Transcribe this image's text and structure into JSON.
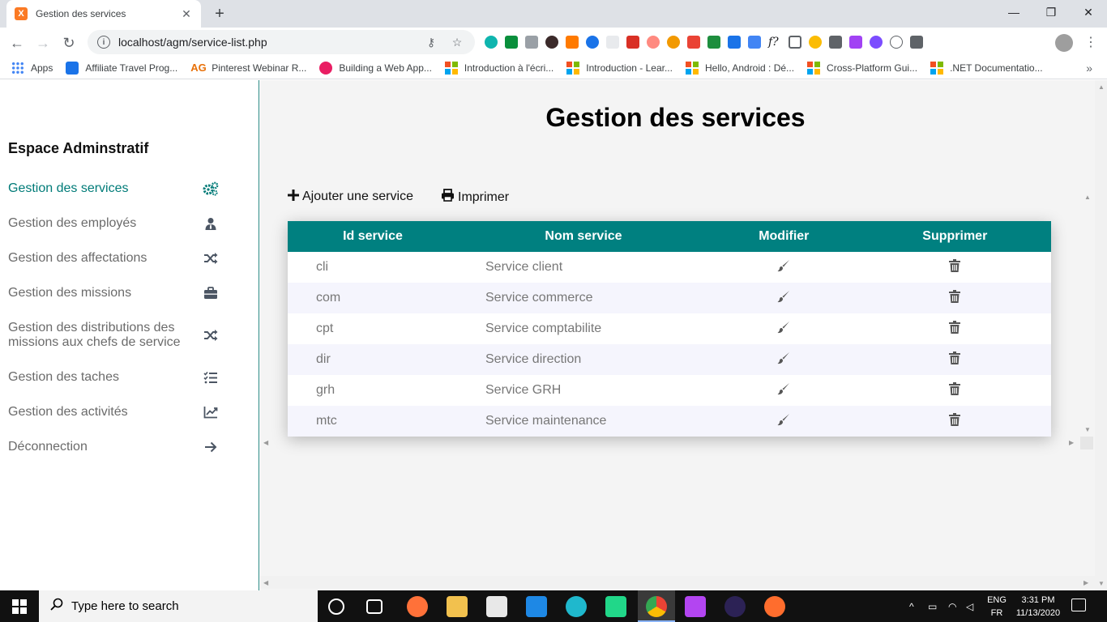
{
  "browser": {
    "tab_title": "Gestion des services",
    "tab_favicon": "X",
    "url": "localhost/agm/service-list.php",
    "bookmarks": [
      {
        "label": "Apps",
        "icon": "apps-grid-icon"
      },
      {
        "label": "Affiliate Travel Prog...",
        "icon": "booking-icon"
      },
      {
        "label": "Pinterest Webinar R...",
        "icon": "ag-icon"
      },
      {
        "label": "Building a Web App...",
        "icon": "play-icon"
      },
      {
        "label": "Introduction à l'écri...",
        "icon": "microsoft-icon"
      },
      {
        "label": "Introduction - Lear...",
        "icon": "microsoft-icon"
      },
      {
        "label": "Hello, Android : Dé...",
        "icon": "microsoft-icon"
      },
      {
        "label": "Cross-Platform Gui...",
        "icon": "microsoft-icon"
      },
      {
        "label": ".NET Documentatio...",
        "icon": "microsoft-icon"
      }
    ]
  },
  "sidebar": {
    "title": "Espace Adminstratif",
    "items": [
      {
        "label": "Gestion des services",
        "icon": "gears-icon",
        "active": true
      },
      {
        "label": "Gestion des employés",
        "icon": "user-tie-icon"
      },
      {
        "label": "Gestion des affectations",
        "icon": "shuffle-icon"
      },
      {
        "label": "Gestion des missions",
        "icon": "briefcase-icon"
      },
      {
        "label": "Gestion des distributions des missions aux chefs de service",
        "label_line1": "Gestion des distributions des",
        "label_line2": "missions aux chefs de service",
        "icon": "shuffle-icon"
      },
      {
        "label": "Gestion des taches",
        "icon": "tasks-icon"
      },
      {
        "label": "Gestion des activités",
        "icon": "chart-line-icon"
      },
      {
        "label": "Déconnection",
        "icon": "arrow-right-icon"
      }
    ]
  },
  "main": {
    "title": "Gestion des services",
    "add_label": "Ajouter une service",
    "print_label": "Imprimer",
    "table": {
      "headers": [
        "Id service",
        "Nom service",
        "Modifier",
        "Supprimer"
      ],
      "rows": [
        {
          "id": "cli",
          "name": "Service client"
        },
        {
          "id": "com",
          "name": "Service commerce"
        },
        {
          "id": "cpt",
          "name": "Service comptabilite"
        },
        {
          "id": "dir",
          "name": "Service direction"
        },
        {
          "id": "grh",
          "name": "Service GRH"
        },
        {
          "id": "mtc",
          "name": "Service maintenance"
        }
      ]
    }
  },
  "taskbar": {
    "search_placeholder": "Type here to search",
    "lang_top": "ENG",
    "lang_bottom": "FR",
    "time": "3:31 PM",
    "date": "11/13/2020"
  },
  "colors": {
    "accent": "#008080",
    "active_nav": "#007b78"
  }
}
